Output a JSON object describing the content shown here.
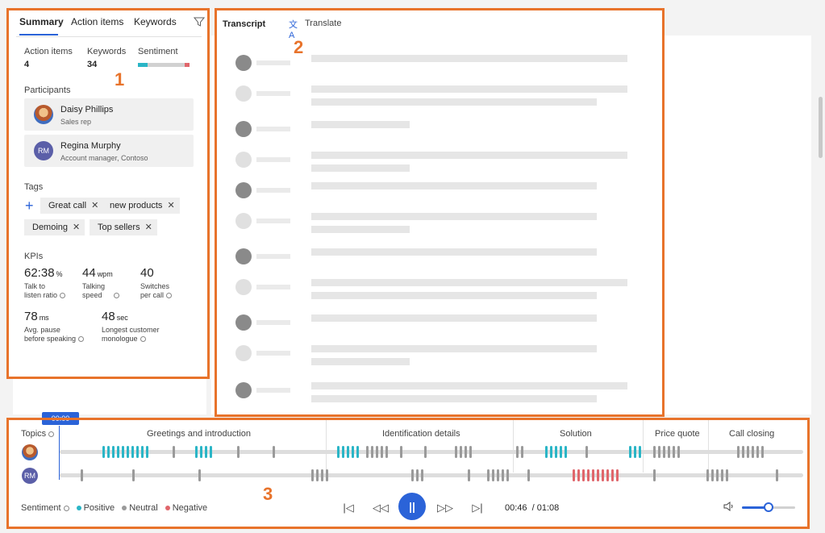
{
  "summary_panel": {
    "tabs": [
      "Summary",
      "Action items",
      "Keywords"
    ],
    "active_tab": "Summary",
    "stats": {
      "action_items_label": "Action items",
      "action_items_value": "4",
      "keywords_label": "Keywords",
      "keywords_value": "34",
      "sentiment_label": "Sentiment",
      "sentiment_positive_fraction": 0.18,
      "sentiment_negative_fraction": 0.09
    },
    "participants_label": "Participants",
    "participants": [
      {
        "name": "Daisy Phillips",
        "role": "Sales rep",
        "avatar": "photo"
      },
      {
        "name": "Regina Murphy",
        "role": "Account manager, Contoso",
        "avatar": "RM"
      }
    ],
    "tags_label": "Tags",
    "tags": [
      "Great call",
      "new products",
      "Demoing",
      "Top sellers"
    ],
    "kpis_label": "KPIs",
    "kpis": [
      {
        "value": "62:38",
        "unit": "%",
        "label_line1": "Talk to",
        "label_line2": "listen ratio"
      },
      {
        "value": "44",
        "unit": "wpm",
        "label_line1": "Talking",
        "label_line2": "speed"
      },
      {
        "value": "40",
        "unit": "",
        "label_line1": "Switches",
        "label_line2": "per call"
      },
      {
        "value": "78",
        "unit": "ms",
        "label_line1": "Avg. pause",
        "label_line2": "before speaking"
      },
      {
        "value": "48",
        "unit": "sec",
        "label_line1": "Longest customer",
        "label_line2": "monologue"
      }
    ]
  },
  "transcript_panel": {
    "title": "Transcript",
    "translate_label": "Translate"
  },
  "timeline": {
    "topics_label": "Topics",
    "playhead_time": "00:00",
    "topics": [
      "Greetings and introduction",
      "Identification details",
      "Solution",
      "Price quote",
      "Call closing"
    ],
    "sentiment_legend_label": "Sentiment",
    "legend": [
      {
        "label": "Positive",
        "color": "#2ab5c6"
      },
      {
        "label": "Neutral",
        "color": "#9a9a9a"
      },
      {
        "label": "Negative",
        "color": "#e0666b"
      }
    ],
    "current_time": "00:46",
    "total_time": "/ 01:08",
    "volume_level": 0.5
  },
  "callouts": [
    "1",
    "2",
    "3"
  ],
  "colors": {
    "accent": "#2b63d8",
    "callout": "#e8732b",
    "positive": "#2ab5c6",
    "neutral": "#9a9a9a",
    "negative": "#e0666b"
  }
}
